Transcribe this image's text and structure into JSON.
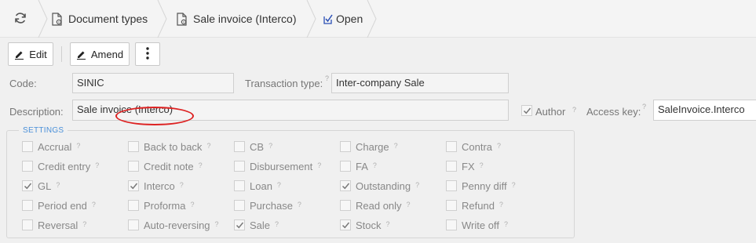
{
  "breadcrumb": {
    "refresh_icon": "refresh-icon",
    "items": [
      {
        "label": "Document types",
        "icon": "document-settings-icon"
      },
      {
        "label": "Sale invoice (Interco)",
        "icon": "document-settings-icon"
      },
      {
        "label": "Open",
        "icon": "open-check-icon"
      }
    ]
  },
  "toolbar": {
    "edit_label": "Edit",
    "amend_label": "Amend",
    "more_icon": "vertical-ellipsis-icon"
  },
  "form": {
    "code_label": "Code:",
    "code_value": "SINIC",
    "transaction_type_label": "Transaction type:",
    "transaction_type_value": "Inter-company Sale",
    "description_label": "Description:",
    "description_value": "Sale invoice (Interco)",
    "author_label": "Author",
    "author_checked": true,
    "access_key_label": "Access key:",
    "access_key_value": "SaleInvoice.Interco",
    "hint": "?"
  },
  "settings": {
    "legend": "SETTINGS",
    "columns": [
      [
        {
          "label": "Accrual",
          "checked": false
        },
        {
          "label": "Credit entry",
          "checked": false
        },
        {
          "label": "GL",
          "checked": true
        },
        {
          "label": "Period end",
          "checked": false
        },
        {
          "label": "Reversal",
          "checked": false
        }
      ],
      [
        {
          "label": "Back to back",
          "checked": false
        },
        {
          "label": "Credit note",
          "checked": false
        },
        {
          "label": "Interco",
          "checked": true
        },
        {
          "label": "Proforma",
          "checked": false
        },
        {
          "label": "Auto-reversing",
          "checked": false
        }
      ],
      [
        {
          "label": "CB",
          "checked": false
        },
        {
          "label": "Disbursement",
          "checked": false
        },
        {
          "label": "Loan",
          "checked": false
        },
        {
          "label": "Purchase",
          "checked": false
        },
        {
          "label": "Sale",
          "checked": true
        }
      ],
      [
        {
          "label": "Charge",
          "checked": false
        },
        {
          "label": "FA",
          "checked": false
        },
        {
          "label": "Outstanding",
          "checked": true
        },
        {
          "label": "Read only",
          "checked": false
        },
        {
          "label": "Stock",
          "checked": true
        }
      ],
      [
        {
          "label": "Contra",
          "checked": false
        },
        {
          "label": "FX",
          "checked": false
        },
        {
          "label": "Penny diff",
          "checked": false
        },
        {
          "label": "Refund",
          "checked": false
        },
        {
          "label": "Write off",
          "checked": false
        }
      ]
    ]
  },
  "colors": {
    "accent": "#4a90d9",
    "highlight_ring": "#dd2222"
  }
}
